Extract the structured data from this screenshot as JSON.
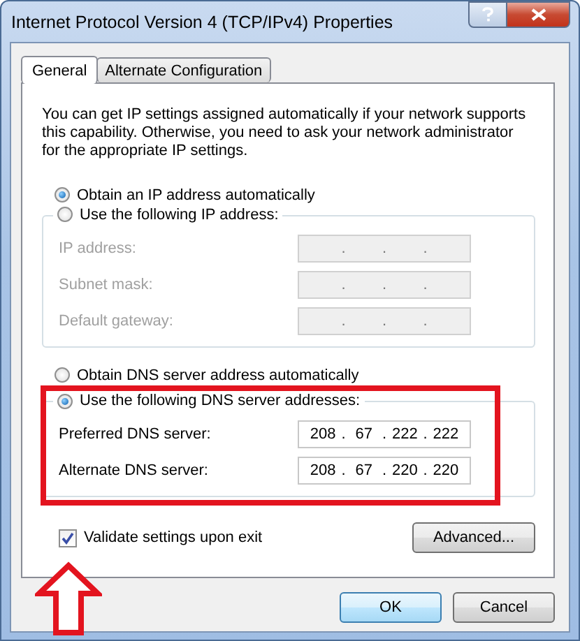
{
  "window": {
    "title": "Internet Protocol Version 4 (TCP/IPv4) Properties"
  },
  "tabs": [
    {
      "label": "General",
      "selected": true
    },
    {
      "label": "Alternate Configuration",
      "selected": false
    }
  ],
  "intro": "You can get IP settings assigned automatically if your network supports this capability. Otherwise, you need to ask your network administrator for the appropriate IP settings.",
  "ip_options": [
    {
      "label": "Obtain an IP address automatically",
      "selected": true
    },
    {
      "label": "Use the following IP address:",
      "selected": false
    }
  ],
  "ip_fields": [
    {
      "label": "IP address:",
      "disabled": true,
      "separators": [
        ".",
        ".",
        "."
      ]
    },
    {
      "label": "Subnet mask:",
      "disabled": true,
      "separators": [
        ".",
        ".",
        "."
      ]
    },
    {
      "label": "Default gateway:",
      "disabled": true,
      "separators": [
        ".",
        ".",
        "."
      ]
    }
  ],
  "dns_options": [
    {
      "label": "Obtain DNS server address automatically",
      "selected": false
    },
    {
      "label": "Use the following DNS server addresses:",
      "selected": true
    }
  ],
  "dns_fields": [
    {
      "label": "Preferred DNS server:",
      "disabled": false,
      "octets": [
        "208",
        "67",
        "222",
        "222"
      ],
      "separators": [
        ".",
        ".",
        "."
      ]
    },
    {
      "label": "Alternate DNS server:",
      "disabled": false,
      "octets": [
        "208",
        "67",
        "220",
        "220"
      ],
      "separators": [
        ".",
        ".",
        "."
      ]
    }
  ],
  "validate": {
    "label": "Validate settings upon exit",
    "checked": true
  },
  "advanced_button": "Advanced...",
  "buttons": [
    {
      "label": "OK",
      "default": true
    },
    {
      "label": "Cancel",
      "default": false
    }
  ]
}
